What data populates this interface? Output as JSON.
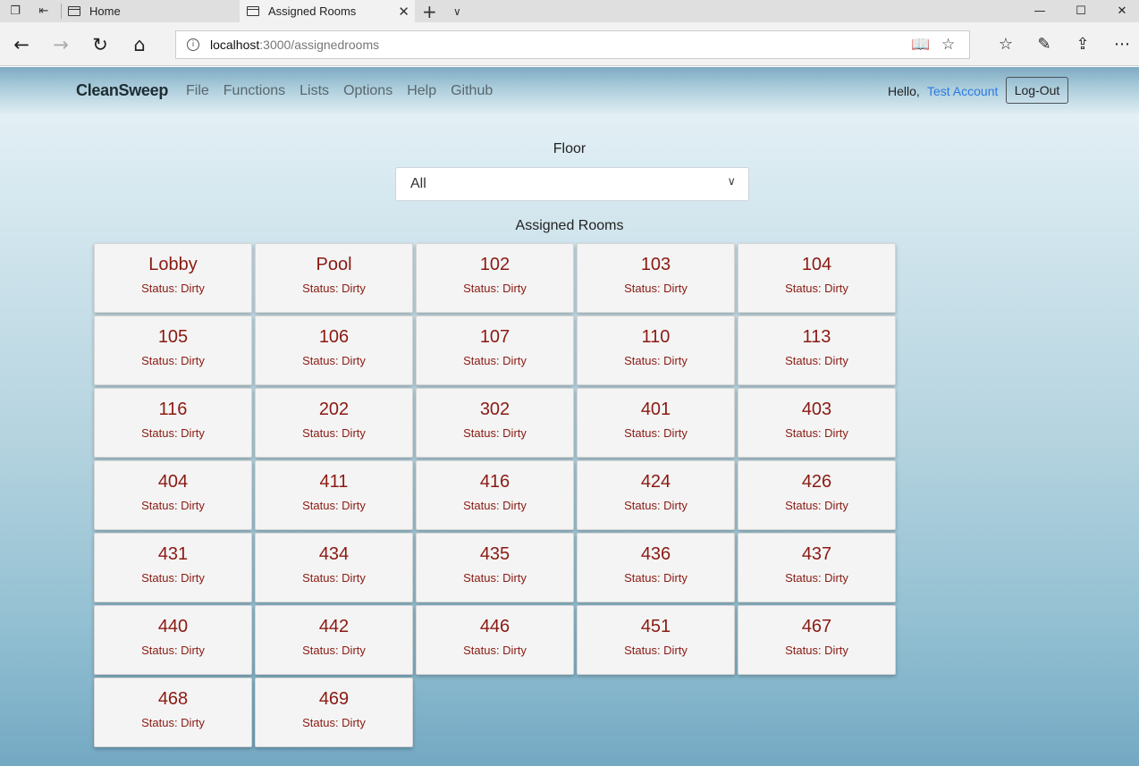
{
  "browser": {
    "tabs": [
      {
        "label": "Home"
      },
      {
        "label": "Assigned Rooms"
      }
    ],
    "url_host": "localhost",
    "url_path": ":3000/assignedrooms"
  },
  "app": {
    "brand": "CleanSweep",
    "menu": [
      "File",
      "Functions",
      "Lists",
      "Options",
      "Help",
      "Github"
    ],
    "greeting": "Hello,",
    "account": "Test Account",
    "logout": "Log-Out"
  },
  "filter": {
    "label": "Floor",
    "selected": "All"
  },
  "rooms_title": "Assigned Rooms",
  "rooms": [
    {
      "name": "Lobby",
      "status": "Status: Dirty"
    },
    {
      "name": "Pool",
      "status": "Status: Dirty"
    },
    {
      "name": "102",
      "status": "Status: Dirty"
    },
    {
      "name": "103",
      "status": "Status: Dirty"
    },
    {
      "name": "104",
      "status": "Status: Dirty"
    },
    {
      "name": "105",
      "status": "Status: Dirty"
    },
    {
      "name": "106",
      "status": "Status: Dirty"
    },
    {
      "name": "107",
      "status": "Status: Dirty"
    },
    {
      "name": "110",
      "status": "Status: Dirty"
    },
    {
      "name": "113",
      "status": "Status: Dirty"
    },
    {
      "name": "116",
      "status": "Status: Dirty"
    },
    {
      "name": "202",
      "status": "Status: Dirty"
    },
    {
      "name": "302",
      "status": "Status: Dirty"
    },
    {
      "name": "401",
      "status": "Status: Dirty"
    },
    {
      "name": "403",
      "status": "Status: Dirty"
    },
    {
      "name": "404",
      "status": "Status: Dirty"
    },
    {
      "name": "411",
      "status": "Status: Dirty"
    },
    {
      "name": "416",
      "status": "Status: Dirty"
    },
    {
      "name": "424",
      "status": "Status: Dirty"
    },
    {
      "name": "426",
      "status": "Status: Dirty"
    },
    {
      "name": "431",
      "status": "Status: Dirty"
    },
    {
      "name": "434",
      "status": "Status: Dirty"
    },
    {
      "name": "435",
      "status": "Status: Dirty"
    },
    {
      "name": "436",
      "status": "Status: Dirty"
    },
    {
      "name": "437",
      "status": "Status: Dirty"
    },
    {
      "name": "440",
      "status": "Status: Dirty"
    },
    {
      "name": "442",
      "status": "Status: Dirty"
    },
    {
      "name": "446",
      "status": "Status: Dirty"
    },
    {
      "name": "451",
      "status": "Status: Dirty"
    },
    {
      "name": "467",
      "status": "Status: Dirty"
    },
    {
      "name": "468",
      "status": "Status: Dirty"
    },
    {
      "name": "469",
      "status": "Status: Dirty"
    }
  ],
  "colors": {
    "room_text": "#8a1a12",
    "link": "#2a7ae2"
  }
}
